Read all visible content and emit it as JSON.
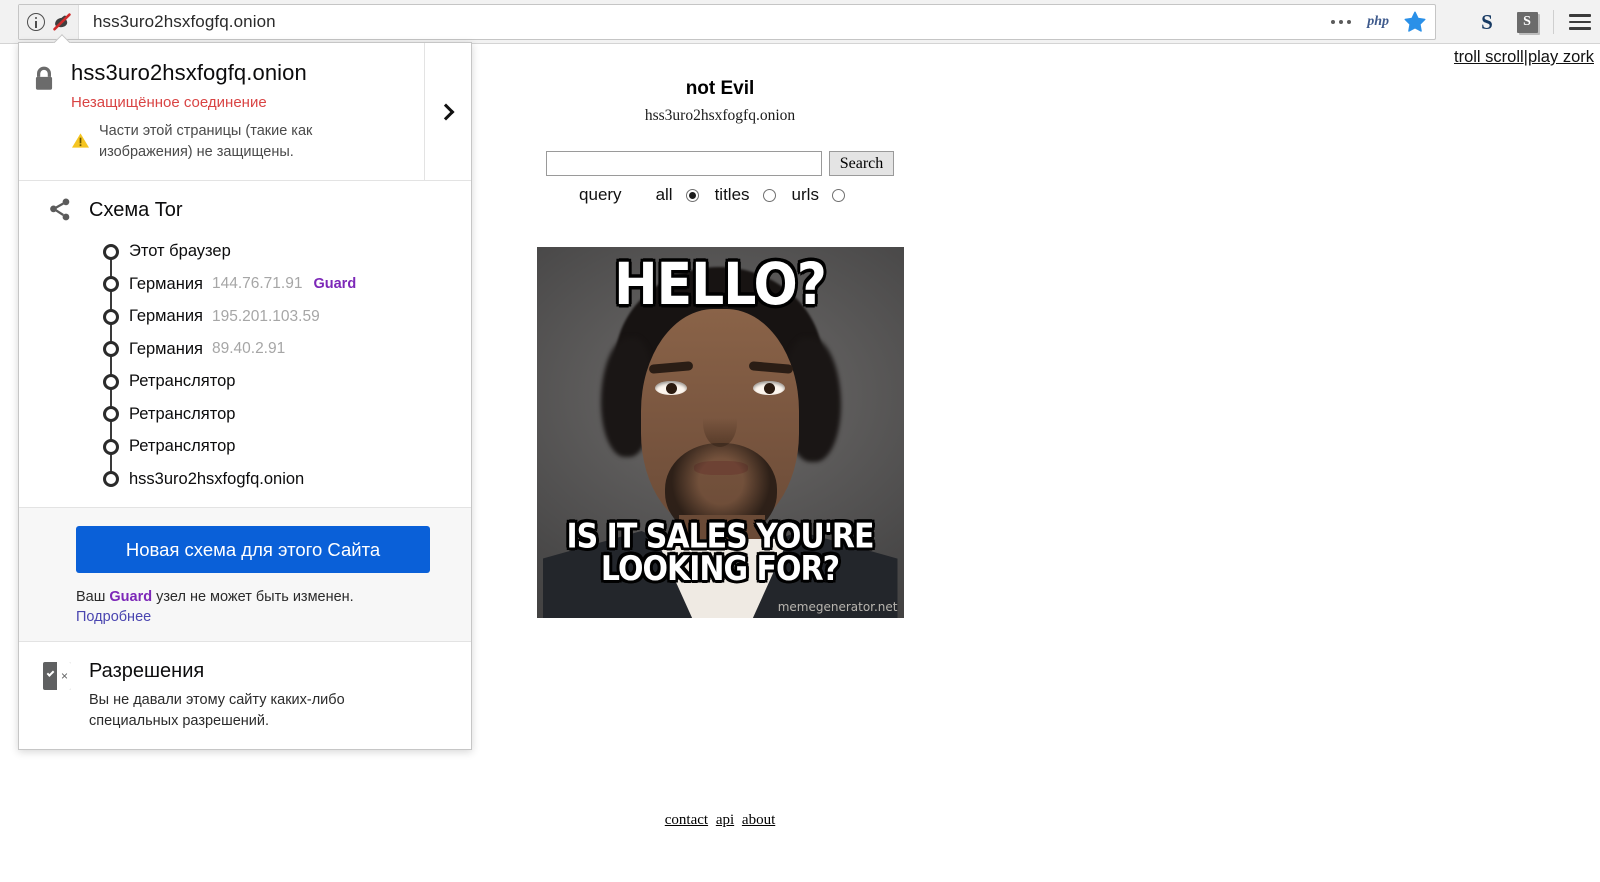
{
  "browser": {
    "url": "hss3uro2hsxfogfq.onion",
    "identity_icon": "info-circle-icon",
    "noscript_icon": "noscript-icon",
    "overflow_icon": "more-dots-icon",
    "php_addon_label": "php",
    "bookmark_icon": "star-icon",
    "toolbar_icon_1": "s-letter-icon",
    "toolbar_icon_2": "s-box-icon",
    "menu_icon": "hamburger-menu-icon"
  },
  "identity_panel": {
    "site_host": "hss3uro2hsxfogfq.onion",
    "connection_status": "Незащищённое соединение",
    "mixed_content_warning": "Части этой страницы (такие как изображения) не защищены.",
    "lock_icon": "lock-icon",
    "warning_icon": "warning-triangle-icon",
    "expand_icon": "chevron-right-icon",
    "circuit": {
      "icon": "tor-circuit-icon",
      "title": "Схема Tor",
      "nodes": [
        {
          "label": "Этот браузер",
          "ip": "",
          "tag": ""
        },
        {
          "label": "Германия",
          "ip": "144.76.71.91",
          "tag": "Guard"
        },
        {
          "label": "Германия",
          "ip": "195.201.103.59",
          "tag": ""
        },
        {
          "label": "Германия",
          "ip": "89.40.2.91",
          "tag": ""
        },
        {
          "label": "Ретранслятор",
          "ip": "",
          "tag": ""
        },
        {
          "label": "Ретранслятор",
          "ip": "",
          "tag": ""
        },
        {
          "label": "Ретранслятор",
          "ip": "",
          "tag": ""
        },
        {
          "label": "hss3uro2hsxfogfq.onion",
          "ip": "",
          "tag": ""
        }
      ]
    },
    "new_circuit_button": "Новая схема для этого Сайта",
    "guard_note_prefix": "Ваш ",
    "guard_note_tag": "Guard",
    "guard_note_suffix": " узел не может быть изменен.",
    "learn_more": "Подробнее",
    "permissions": {
      "icon": "permissions-icon",
      "title": "Разрешения",
      "description": "Вы не давали этому сайту каких-либо специальных разрешений."
    }
  },
  "page": {
    "corner_links": {
      "left": "troll scroll",
      "separator": "|",
      "right": "play zork"
    },
    "brand": "not Evil",
    "brand_subtitle": "hss3uro2hsxfogfq.onion",
    "search": {
      "value": "",
      "placeholder": "",
      "button_label": "Search",
      "query_label": "query",
      "options": [
        {
          "label": "all",
          "selected": false
        },
        {
          "label": "titles",
          "selected": true
        },
        {
          "label": "urls",
          "selected": false
        }
      ]
    },
    "meme": {
      "top_text": "HELLO?",
      "bottom_text": "IS IT SALES YOU'RE LOOKING FOR?",
      "credit": "memegenerator.net"
    },
    "footer_links": [
      "contact",
      "api",
      "about"
    ]
  },
  "colors": {
    "accent_blue": "#0a60d8",
    "guard_purple": "#7d28b8",
    "insecure_red": "#d94444",
    "link_violet": "#4a45b0"
  }
}
